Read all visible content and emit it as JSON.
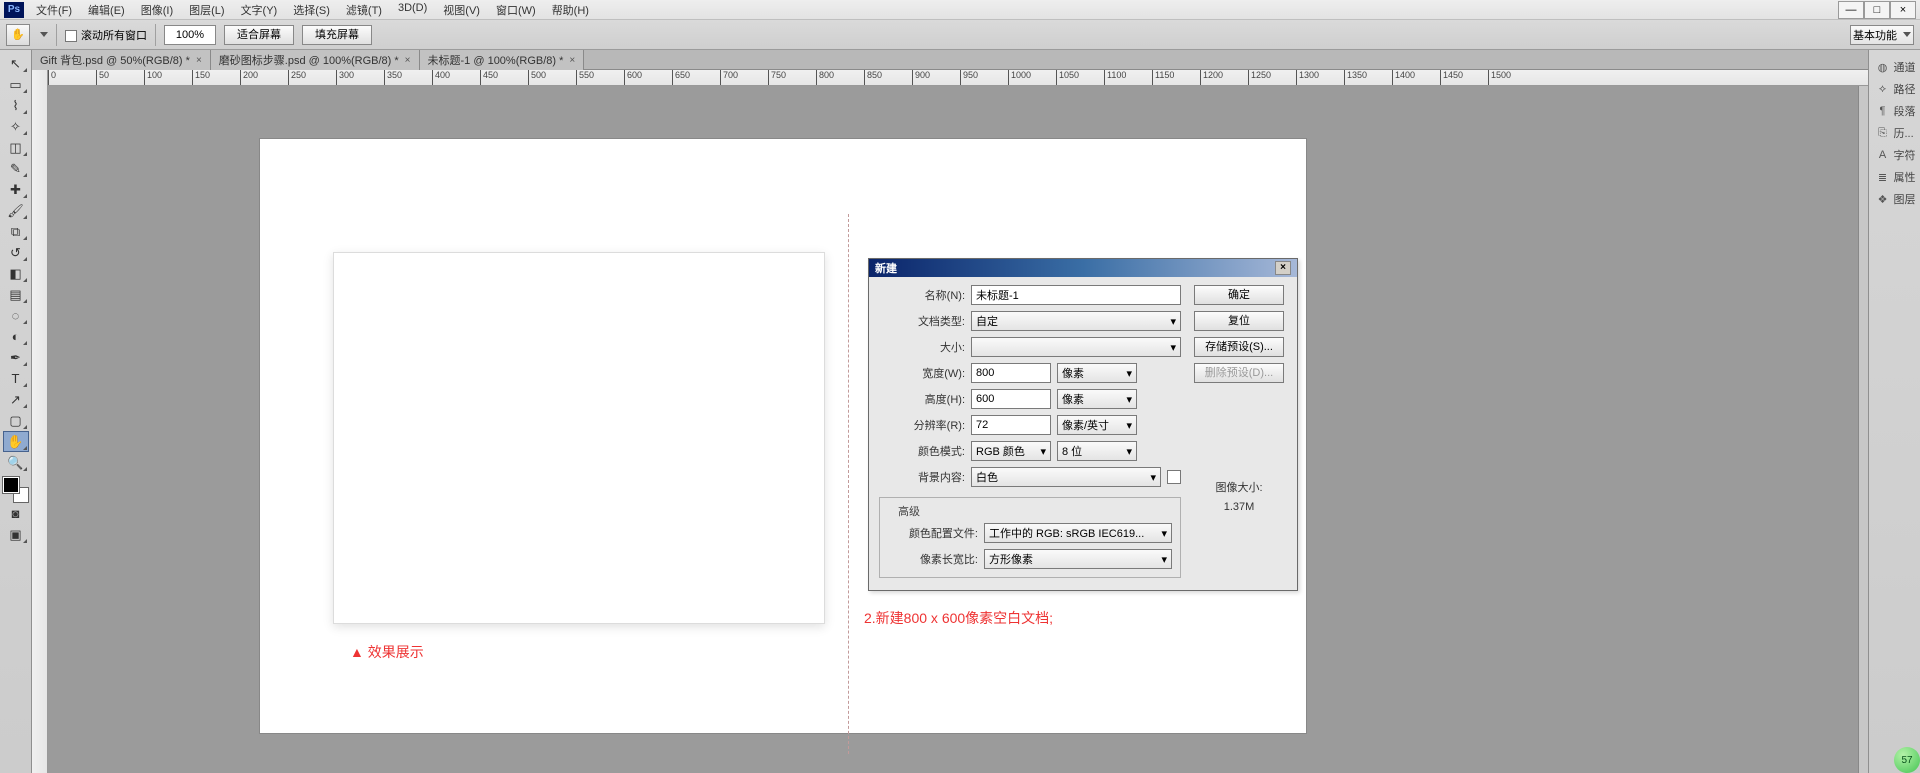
{
  "menu": {
    "items": [
      "文件(F)",
      "编辑(E)",
      "图像(I)",
      "图层(L)",
      "文字(Y)",
      "选择(S)",
      "滤镜(T)",
      "3D(D)",
      "视图(V)",
      "窗口(W)",
      "帮助(H)"
    ]
  },
  "logo": "Ps",
  "window_ctl": {
    "min": "—",
    "max": "□",
    "close": "×"
  },
  "optbar": {
    "scroll_all": "滚动所有窗口",
    "zoom": "100%",
    "fit": "适合屏幕",
    "fill": "填充屏幕",
    "workspace": "基本功能"
  },
  "tabs": [
    {
      "label": "Gift 背包.psd @ 50%(RGB/8) *"
    },
    {
      "label": "磨砂图标步骤.psd @ 100%(RGB/8) *"
    },
    {
      "label": "未标题-1 @ 100%(RGB/8) *"
    }
  ],
  "ruler_ticks": [
    "0",
    "50",
    "100",
    "150",
    "200",
    "250",
    "300",
    "350",
    "400",
    "450",
    "500",
    "550",
    "600",
    "650",
    "700",
    "750",
    "800",
    "850",
    "900",
    "950",
    "1000",
    "1050",
    "1100",
    "1150",
    "1200",
    "1250",
    "1300",
    "1350",
    "1400",
    "1450",
    "1500"
  ],
  "ltools": [
    "move",
    "marquee",
    "lasso",
    "wand",
    "crop",
    "eyedropper",
    "heal",
    "brush",
    "stamp",
    "history-brush",
    "eraser",
    "gradient",
    "blur",
    "dodge",
    "pen",
    "type",
    "path-select",
    "rectangle",
    "hand",
    "zoom"
  ],
  "rpanel": [
    {
      "icon": "◍",
      "label": "通道"
    },
    {
      "icon": "⟡",
      "label": "路径"
    },
    {
      "icon": "¶",
      "label": "段落"
    },
    {
      "icon": "⎘",
      "label": "历..."
    },
    {
      "icon": "A",
      "label": "字符"
    },
    {
      "icon": "≣",
      "label": "属性"
    },
    {
      "icon": "❖",
      "label": "图层"
    }
  ],
  "dialog": {
    "title": "新建",
    "name_label": "名称(N):",
    "name_value": "未标题-1",
    "doctype_label": "文档类型:",
    "doctype_value": "自定",
    "size_label": "大小:",
    "size_value": "",
    "width_label": "宽度(W):",
    "width_value": "800",
    "width_unit": "像素",
    "height_label": "高度(H):",
    "height_value": "600",
    "height_unit": "像素",
    "res_label": "分辨率(R):",
    "res_value": "72",
    "res_unit": "像素/英寸",
    "mode_label": "颜色模式:",
    "mode_value": "RGB 颜色",
    "mode_bits": "8 位",
    "bg_label": "背景内容:",
    "bg_value": "白色",
    "adv_title": "高级",
    "profile_label": "颜色配置文件:",
    "profile_value": "工作中的 RGB: sRGB IEC619...",
    "aspect_label": "像素长宽比:",
    "aspect_value": "方形像素",
    "ok": "确定",
    "reset": "复位",
    "save_preset": "存储预设(S)...",
    "del_preset": "删除预设(D)...",
    "imgsize_label": "图像大小:",
    "imgsize_value": "1.37M"
  },
  "captions": {
    "c1": "▲  效果展示",
    "c2": "2.新建800 x 600像素空白文档;"
  },
  "badge": "57"
}
